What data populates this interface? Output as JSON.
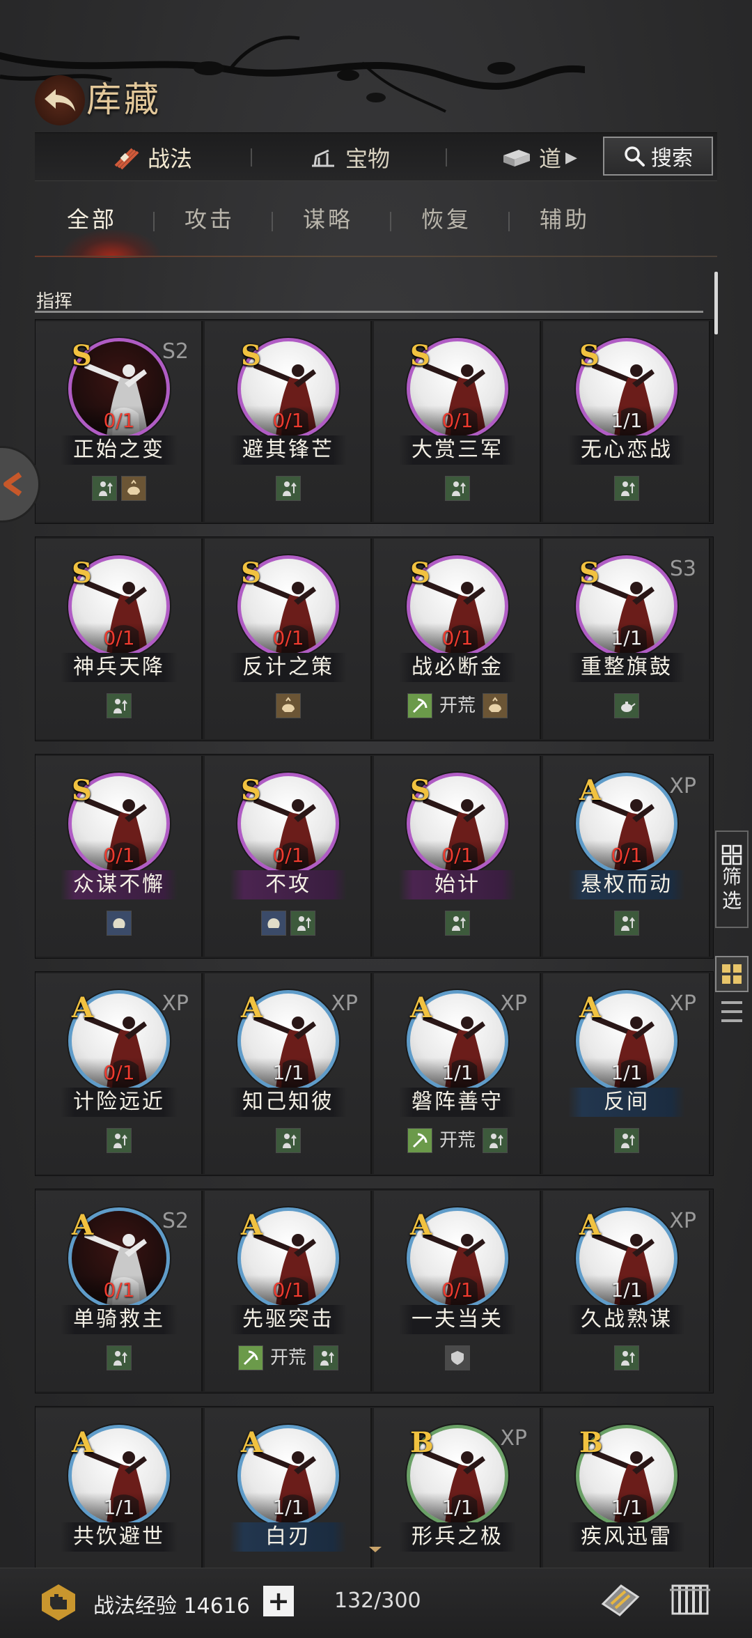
{
  "header": {
    "title": "库藏",
    "back_icon": "back-arrow-icon"
  },
  "top_tabs": [
    {
      "label": "战法",
      "icon": "bundle-icon",
      "active": true
    },
    {
      "label": "宝物",
      "icon": "cannon-icon",
      "active": false
    },
    {
      "label": "道",
      "icon": "item-icon",
      "active": false
    }
  ],
  "search": {
    "label": "搜索"
  },
  "sub_tabs": [
    {
      "label": "全部",
      "active": true
    },
    {
      "label": "攻击",
      "active": false
    },
    {
      "label": "谋略",
      "active": false
    },
    {
      "label": "恢复",
      "active": false
    },
    {
      "label": "辅助",
      "active": false
    }
  ],
  "section": {
    "title": "指挥"
  },
  "colors": {
    "grade_S": "#b05cc4",
    "grade_A": "#5f9cc9",
    "grade_B": "#6aa066",
    "gold": "#f1c240",
    "zero_count": "#ee3b2f"
  },
  "rows": [
    {
      "cards": [
        {
          "grade": "S",
          "season": "S2",
          "count": "0/1",
          "name": "正始之变",
          "tags": [
            {
              "icon": "soldier-up-icon"
            },
            {
              "icon": "helmet-icon"
            }
          ]
        },
        {
          "grade": "S",
          "season": "",
          "count": "0/1",
          "name": "避其锋芒",
          "tags": [
            {
              "icon": "soldier-up-icon"
            }
          ]
        },
        {
          "grade": "S",
          "season": "",
          "count": "0/1",
          "name": "大赏三军",
          "tags": [
            {
              "icon": "soldier-up-icon"
            }
          ]
        },
        {
          "grade": "S",
          "season": "",
          "count": "1/1",
          "name": "无心恋战",
          "tags": [
            {
              "icon": "soldier-up-icon"
            }
          ]
        }
      ]
    },
    {
      "cards": [
        {
          "grade": "S",
          "season": "",
          "count": "0/1",
          "name": "神兵天降",
          "tags": [
            {
              "icon": "soldier-up-icon"
            }
          ]
        },
        {
          "grade": "S",
          "season": "",
          "count": "0/1",
          "name": "反计之策",
          "tags": [
            {
              "icon": "helmet-icon"
            }
          ]
        },
        {
          "grade": "S",
          "season": "",
          "count": "0/1",
          "name": "战必断金",
          "tags": [
            {
              "icon": "pickaxe-icon",
              "text": "开荒"
            },
            {
              "icon": "helmet-icon"
            }
          ]
        },
        {
          "grade": "S",
          "season": "S3",
          "count": "1/1",
          "name": "重整旗鼓",
          "tags": [
            {
              "icon": "teapot-icon"
            }
          ]
        }
      ]
    },
    {
      "cards": [
        {
          "grade": "S",
          "season": "",
          "count": "0/1",
          "name": "众谋不懈",
          "tags": [
            {
              "icon": "brain-icon"
            }
          ]
        },
        {
          "grade": "S",
          "season": "",
          "count": "0/1",
          "name": "不攻",
          "tags": [
            {
              "icon": "brain-icon"
            },
            {
              "icon": "soldier-up-icon"
            }
          ]
        },
        {
          "grade": "S",
          "season": "",
          "count": "0/1",
          "name": "始计",
          "tags": [
            {
              "icon": "soldier-up-icon"
            }
          ]
        },
        {
          "grade": "A",
          "season": "XP",
          "count": "0/1",
          "name": "悬权而动",
          "tags": [
            {
              "icon": "soldier-up-icon"
            }
          ]
        }
      ]
    },
    {
      "cards": [
        {
          "grade": "A",
          "season": "XP",
          "count": "0/1",
          "name": "计险远近",
          "tags": [
            {
              "icon": "soldier-up-icon"
            }
          ]
        },
        {
          "grade": "A",
          "season": "XP",
          "count": "1/1",
          "name": "知己知彼",
          "tags": [
            {
              "icon": "soldier-up-icon"
            }
          ]
        },
        {
          "grade": "A",
          "season": "XP",
          "count": "1/1",
          "name": "磐阵善守",
          "tags": [
            {
              "icon": "pickaxe-icon",
              "text": "开荒"
            },
            {
              "icon": "soldier-up-icon"
            }
          ]
        },
        {
          "grade": "A",
          "season": "XP",
          "count": "1/1",
          "name": "反间",
          "tags": [
            {
              "icon": "soldier-up-icon"
            }
          ]
        }
      ]
    },
    {
      "cards": [
        {
          "grade": "A",
          "season": "S2",
          "count": "0/1",
          "name": "单骑救主",
          "tags": [
            {
              "icon": "soldier-up-icon"
            }
          ]
        },
        {
          "grade": "A",
          "season": "",
          "count": "0/1",
          "name": "先驱突击",
          "tags": [
            {
              "icon": "pickaxe-icon",
              "text": "开荒"
            },
            {
              "icon": "soldier-up-icon"
            }
          ]
        },
        {
          "grade": "A",
          "season": "",
          "count": "0/1",
          "name": "一夫当关",
          "tags": [
            {
              "icon": "shield-icon"
            }
          ]
        },
        {
          "grade": "A",
          "season": "XP",
          "count": "1/1",
          "name": "久战熟谋",
          "tags": [
            {
              "icon": "soldier-up-icon"
            }
          ]
        }
      ]
    },
    {
      "cards": [
        {
          "grade": "A",
          "season": "",
          "count": "1/1",
          "name": "共饮避世",
          "tags": []
        },
        {
          "grade": "A",
          "season": "",
          "count": "1/1",
          "name": "白刃",
          "tags": []
        },
        {
          "grade": "B",
          "season": "XP",
          "count": "1/1",
          "name": "形兵之极",
          "tags": []
        },
        {
          "grade": "B",
          "season": "",
          "count": "1/1",
          "name": "疾风迅雷",
          "tags": []
        }
      ]
    }
  ],
  "side": {
    "filter_label": "筛选"
  },
  "bottom": {
    "exp_label": "战法经验 14616",
    "plus": "+",
    "capacity": "132/300"
  }
}
